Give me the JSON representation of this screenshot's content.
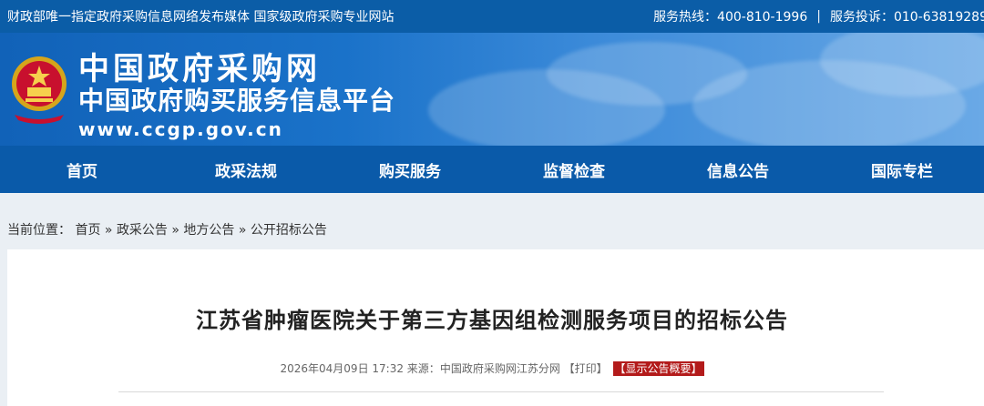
{
  "topbar": {
    "left": "财政部唯一指定政府采购信息网络发布媒体 国家级政府采购专业网站",
    "hotline": "服务热线：400-810-1996",
    "separator": "|",
    "complaint": "服务投诉：010-63819289"
  },
  "banner": {
    "title_cn": "中国政府采购网",
    "subtitle_cn": "中国政府购买服务信息平台",
    "url": "www.ccgp.gov.cn"
  },
  "nav": {
    "items": [
      "首页",
      "政采法规",
      "购买服务",
      "监督检查",
      "信息公告",
      "国际专栏"
    ]
  },
  "breadcrumb": {
    "prefix": "当前位置：",
    "items": [
      "首页",
      "政采公告",
      "地方公告",
      "公开招标公告"
    ],
    "separator": "»"
  },
  "article": {
    "title": "江苏省肿瘤医院关于第三方基因组检测服务项目的招标公告",
    "datetime": "2026年04月09日 17:32",
    "source_label": "来源：",
    "source": "中国政府采购网江苏分网",
    "print": "【打印】",
    "summary": "【显示公告概要】"
  },
  "colors": {
    "topbar": "#0b5da7",
    "nav": "#0a5aa9",
    "badge": "#b31b1b"
  }
}
